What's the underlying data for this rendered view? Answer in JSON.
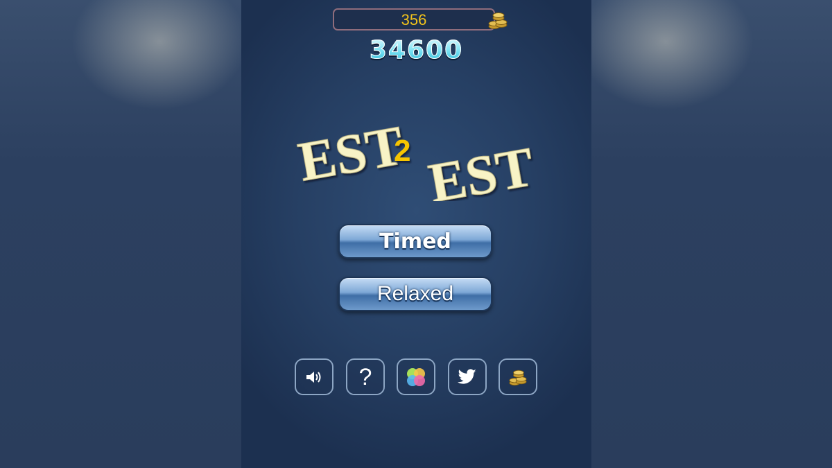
{
  "hud": {
    "coins": "356",
    "coin_icon": "coin-stack-icon",
    "score": "34600"
  },
  "logo": {
    "word1": "EST",
    "connector": "2",
    "word2": "EST"
  },
  "menu": {
    "timed_label": "Timed",
    "relaxed_label": "Relaxed"
  },
  "toolbar": {
    "icons": [
      "sound-icon",
      "help-icon",
      "game-center-icon",
      "twitter-icon",
      "coin-stack-icon"
    ],
    "help_label": "?"
  },
  "colors": {
    "background": "#263f63",
    "coin_text": "#f2c31b",
    "logo_text": "#f8f3c6",
    "logo_connector": "#f5c400",
    "score_cyan": "#22b6d6",
    "button_blue": "#6e9acb"
  }
}
